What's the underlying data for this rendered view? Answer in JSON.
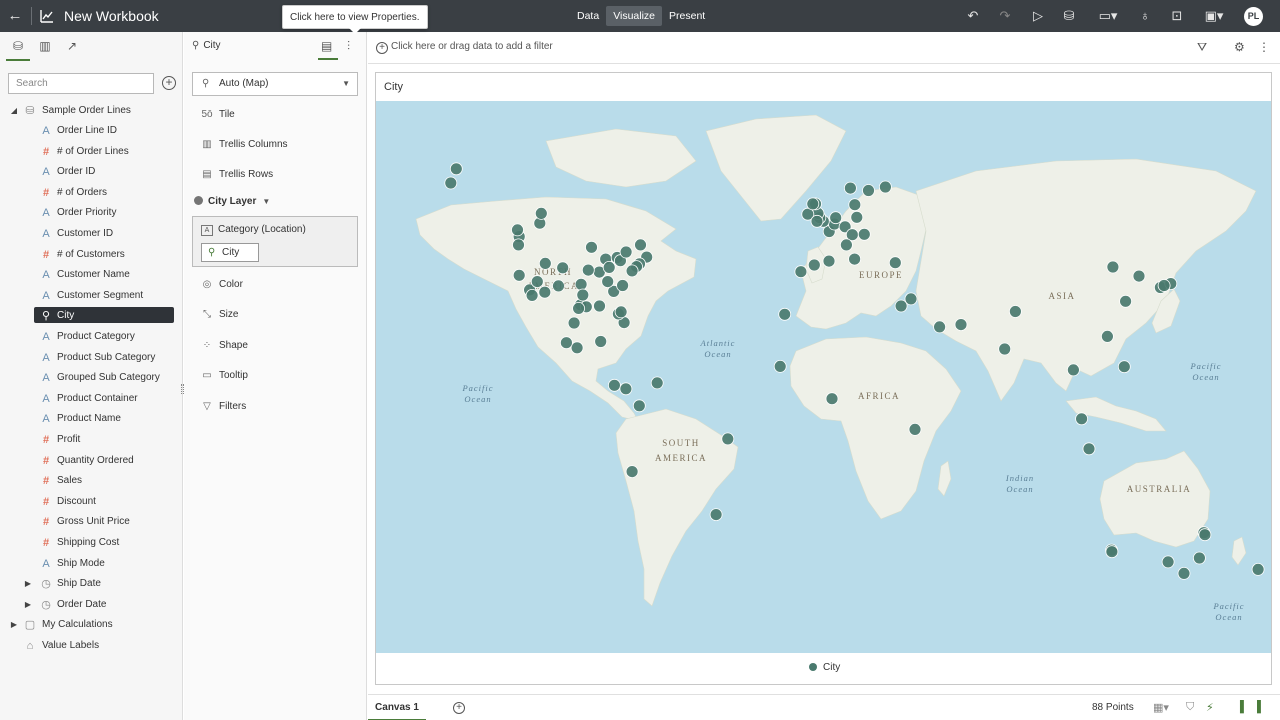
{
  "header": {
    "title": "New Workbook",
    "tooltip": "Click here to view Properties.",
    "modes": [
      "Data",
      "Visualize",
      "Present"
    ],
    "active_mode": "Visualize",
    "user_initials": "PL"
  },
  "data_panel": {
    "search_placeholder": "Search",
    "root": "Sample Order Lines",
    "items": [
      {
        "label": "Order Line ID",
        "type": "attr"
      },
      {
        "label": "# of Order Lines",
        "type": "meas"
      },
      {
        "label": "Order ID",
        "type": "attr"
      },
      {
        "label": "# of Orders",
        "type": "meas"
      },
      {
        "label": "Order Priority",
        "type": "attr"
      },
      {
        "label": "Customer ID",
        "type": "attr"
      },
      {
        "label": "# of Customers",
        "type": "meas"
      },
      {
        "label": "Customer Name",
        "type": "attr"
      },
      {
        "label": "Customer Segment",
        "type": "attr"
      },
      {
        "label": "City",
        "type": "geo"
      },
      {
        "label": "Product Category",
        "type": "attr"
      },
      {
        "label": "Product Sub Category",
        "type": "attr"
      },
      {
        "label": "Grouped Sub Category",
        "type": "attr"
      },
      {
        "label": "Product Container",
        "type": "attr"
      },
      {
        "label": "Product Name",
        "type": "attr"
      },
      {
        "label": "Profit",
        "type": "meas"
      },
      {
        "label": "Quantity Ordered",
        "type": "meas"
      },
      {
        "label": "Sales",
        "type": "meas"
      },
      {
        "label": "Discount",
        "type": "meas"
      },
      {
        "label": "Gross Unit Price",
        "type": "meas"
      },
      {
        "label": "Shipping Cost",
        "type": "meas"
      },
      {
        "label": "Ship Mode",
        "type": "attr"
      },
      {
        "label": "Ship Date",
        "type": "date"
      },
      {
        "label": "Order Date",
        "type": "date"
      }
    ],
    "my_calculations": "My Calculations",
    "value_labels": "Value Labels"
  },
  "grammar": {
    "header": "City",
    "viz_type": "Auto (Map)",
    "tile": "Tile",
    "trellis_columns": "Trellis Columns",
    "trellis_rows": "Trellis Rows",
    "layer": "City Layer",
    "category_label": "Category (Location)",
    "category_value": "City",
    "color": "Color",
    "size": "Size",
    "shape": "Shape",
    "tooltip": "Tooltip",
    "filters": "Filters"
  },
  "filter_bar": {
    "placeholder": "Click here or drag data to add a filter"
  },
  "viz": {
    "title": "City",
    "legend": "City",
    "map_labels": {
      "north_america": [
        "NORTH",
        "AMERICA"
      ],
      "south_america": [
        "SOUTH",
        "AMERICA"
      ],
      "europe": "EUROPE",
      "asia": "ASIA",
      "africa": "AFRICA",
      "australia": "AUSTRALIA",
      "atlantic": [
        "Atlantic",
        "Ocean"
      ],
      "pacific_west": [
        "Pacific",
        "Ocean"
      ],
      "pacific_east": [
        "Pacific",
        "Ocean"
      ],
      "pacific_se": [
        "Pacific",
        "Ocean"
      ],
      "indian": [
        "Indian",
        "Ocean"
      ]
    },
    "colors": {
      "point": "#4a7a6e",
      "ocean": "#b9dcea",
      "land": "#eef0e8"
    },
    "points": [
      [
        -149.9,
        61.2
      ],
      [
        -147.7,
        64.8
      ],
      [
        -122.4,
        47.6
      ],
      [
        -122.7,
        45.5
      ],
      [
        -123.1,
        49.3
      ],
      [
        -114.1,
        51.0
      ],
      [
        -113.5,
        53.5
      ],
      [
        -122.4,
        37.8
      ],
      [
        -118.2,
        34.1
      ],
      [
        -117.2,
        32.7
      ],
      [
        -112.1,
        33.5
      ],
      [
        -115.1,
        36.2
      ],
      [
        -111.9,
        40.8
      ],
      [
        -104.9,
        39.7
      ],
      [
        -106.6,
        35.1
      ],
      [
        -97.5,
        35.5
      ],
      [
        -97.7,
        30.3
      ],
      [
        -96.8,
        32.8
      ],
      [
        -95.4,
        29.8
      ],
      [
        -98.5,
        29.4
      ],
      [
        -93.3,
        44.9
      ],
      [
        -90.2,
        38.6
      ],
      [
        -94.6,
        39.1
      ],
      [
        -87.6,
        41.9
      ],
      [
        -86.2,
        39.8
      ],
      [
        -83.0,
        42.3
      ],
      [
        -84.4,
        33.7
      ],
      [
        -86.8,
        36.2
      ],
      [
        -90.1,
        30.0
      ],
      [
        -81.7,
        41.5
      ],
      [
        -79.4,
        43.7
      ],
      [
        -73.6,
        45.5
      ],
      [
        -71.1,
        42.4
      ],
      [
        -74.0,
        40.7
      ],
      [
        -75.2,
        40.0
      ],
      [
        -77.0,
        38.9
      ],
      [
        -80.8,
        35.2
      ],
      [
        -80.2,
        25.8
      ],
      [
        -82.5,
        28.0
      ],
      [
        -81.4,
        28.5
      ],
      [
        -99.1,
        19.4
      ],
      [
        -103.4,
        20.7
      ],
      [
        -100.3,
        25.7
      ],
      [
        -89.6,
        21.0
      ],
      [
        -84.1,
        9.9
      ],
      [
        -79.5,
        9.0
      ],
      [
        -74.1,
        4.7
      ],
      [
        -66.9,
        10.5
      ],
      [
        -77.0,
        -12.0
      ],
      [
        -38.5,
        -3.7
      ],
      [
        -43.2,
        -22.9
      ],
      [
        -17.4,
        14.7
      ],
      [
        -15.6,
        27.9
      ],
      [
        -3.7,
        40.4
      ],
      [
        -9.1,
        38.7
      ],
      [
        2.2,
        41.4
      ],
      [
        2.3,
        48.9
      ],
      [
        4.4,
        50.8
      ],
      [
        4.9,
        52.4
      ],
      [
        -0.1,
        51.5
      ],
      [
        -1.5,
        52.4
      ],
      [
        -2.2,
        53.5
      ],
      [
        -3.2,
        55.9
      ],
      [
        -6.3,
        53.3
      ],
      [
        -4.3,
        55.9
      ],
      [
        -2.6,
        51.5
      ],
      [
        8.7,
        50.1
      ],
      [
        13.4,
        52.5
      ],
      [
        11.6,
        48.1
      ],
      [
        16.4,
        48.2
      ],
      [
        12.5,
        41.9
      ],
      [
        9.2,
        45.5
      ],
      [
        18.1,
        59.3
      ],
      [
        10.8,
        59.9
      ],
      [
        12.6,
        55.7
      ],
      [
        24.9,
        60.2
      ],
      [
        28.9,
        41.0
      ],
      [
        31.2,
        30.0
      ],
      [
        35.2,
        31.8
      ],
      [
        46.7,
        24.7
      ],
      [
        55.3,
        25.3
      ],
      [
        3.4,
        6.5
      ],
      [
        36.8,
        -1.3
      ],
      [
        72.9,
        19.1
      ],
      [
        77.2,
        28.6
      ],
      [
        100.5,
        13.8
      ],
      [
        103.8,
        1.4
      ],
      [
        106.8,
        -6.2
      ],
      [
        114.2,
        22.3
      ],
      [
        121.5,
        31.2
      ],
      [
        116.4,
        39.9
      ],
      [
        121.0,
        14.6
      ],
      [
        126.9,
        37.6
      ],
      [
        135.5,
        34.7
      ],
      [
        139.7,
        35.7
      ],
      [
        137.0,
        35.2
      ],
      [
        115.9,
        -31.9
      ],
      [
        116.0,
        -32.3
      ],
      [
        138.6,
        -34.9
      ],
      [
        145.0,
        -37.8
      ],
      [
        151.2,
        -33.9
      ],
      [
        153.0,
        -27.5
      ],
      [
        153.4,
        -28.0
      ],
      [
        174.8,
        -36.8
      ]
    ]
  },
  "bottom_bar": {
    "canvas_tab": "Canvas 1",
    "points_label": "88 Points"
  }
}
